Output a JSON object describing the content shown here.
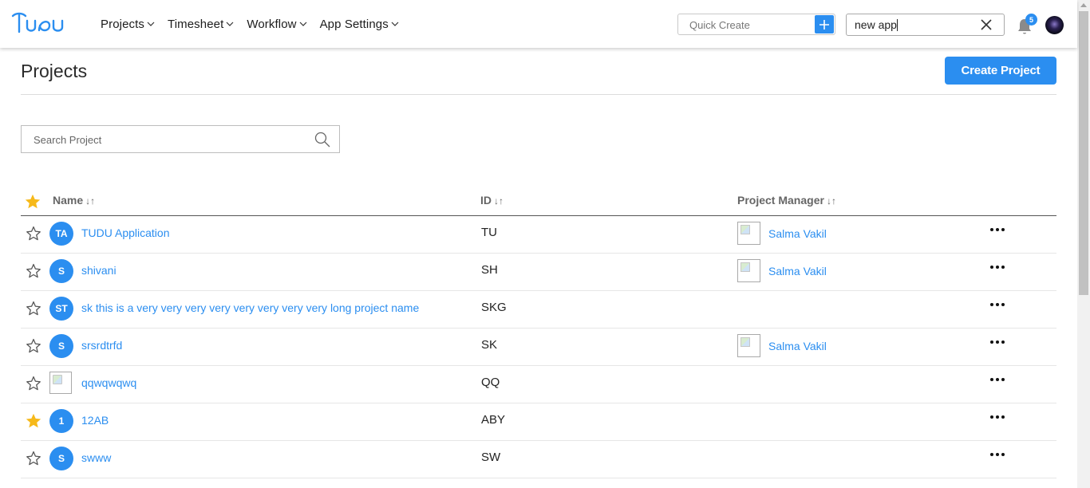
{
  "app": {
    "logo_text": "TUDU"
  },
  "nav": {
    "items": [
      {
        "label": "Projects"
      },
      {
        "label": "Timesheet"
      },
      {
        "label": "Workflow"
      },
      {
        "label": "App Settings"
      }
    ]
  },
  "quick_create": {
    "placeholder": "Quick Create"
  },
  "global_search": {
    "value": "new app"
  },
  "notifications": {
    "count": "5"
  },
  "page": {
    "title": "Projects",
    "create_button": "Create Project",
    "search_placeholder": "Search Project"
  },
  "table": {
    "columns": [
      {
        "label": "Name",
        "sort": "↓↑"
      },
      {
        "label": "ID",
        "sort": "↓↑"
      },
      {
        "label": "Project Manager",
        "sort": "↓↑"
      }
    ],
    "rows": [
      {
        "starred": false,
        "initials": "TA",
        "name": "TUDU Application",
        "id": "TU",
        "manager": "Salma Vakil"
      },
      {
        "starred": false,
        "initials": "S",
        "name": "shivani",
        "id": "SH",
        "manager": "Salma Vakil"
      },
      {
        "starred": false,
        "initials": "ST",
        "name": "sk this is a very very very very very very very very long project name",
        "id": "SKG",
        "manager": ""
      },
      {
        "starred": false,
        "initials": "S",
        "name": "srsrdtrfd",
        "id": "SK",
        "manager": "Salma Vakil"
      },
      {
        "starred": false,
        "initials": "",
        "name": "qqwqwqwq",
        "id": "QQ",
        "manager": ""
      },
      {
        "starred": true,
        "initials": "1",
        "name": "12AB",
        "id": "ABY",
        "manager": ""
      },
      {
        "starred": false,
        "initials": "S",
        "name": "swww",
        "id": "SW",
        "manager": ""
      }
    ]
  },
  "colors": {
    "accent": "#2b8ef0",
    "star": "#f6b91a"
  },
  "icons": [
    "chevron-down-icon",
    "plus-icon",
    "close-icon",
    "bell-icon",
    "search-icon",
    "star-icon",
    "more-icon"
  ]
}
